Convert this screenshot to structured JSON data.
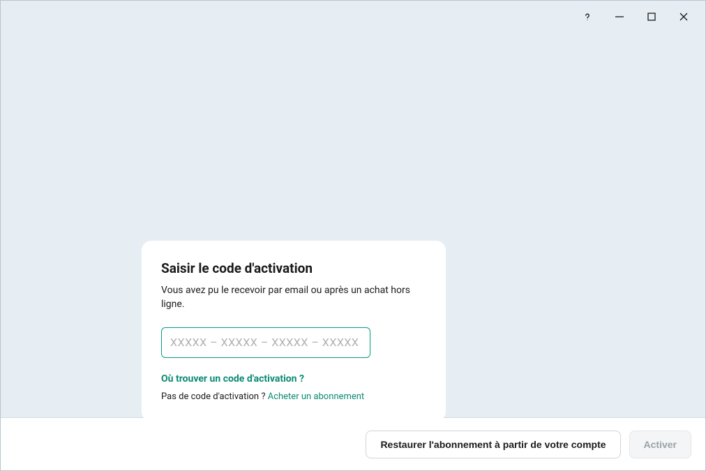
{
  "card": {
    "title": "Saisir le code d'activation",
    "subtitle": "Vous avez pu le recevoir par email ou après un achat hors ligne.",
    "input_placeholder": "XXXXX – XXXXX – XXXXX – XXXXX",
    "help_link": "Où trouver un code d'activation ?",
    "no_code_prefix": "Pas de code d'activation ? ",
    "buy_link": "Acheter un abonnement"
  },
  "footer": {
    "restore_label": "Restaurer l'abonnement à partir de votre compte",
    "activate_label": "Activer"
  }
}
